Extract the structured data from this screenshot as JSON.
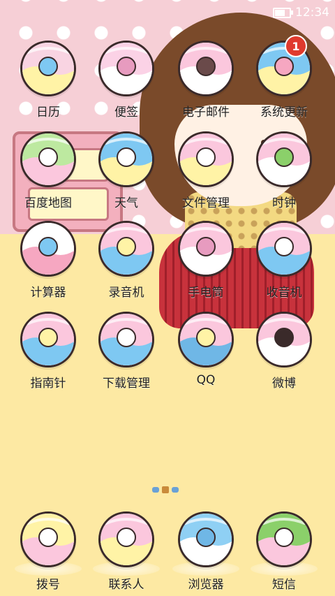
{
  "status_bar": {
    "time": "12:34",
    "battery_level_percent": 70
  },
  "apps": [
    {
      "id": "calendar",
      "label": "日历",
      "icon": "calendar-icon",
      "colors": [
        "#f9d4e2",
        "#fff3a6",
        "#7ec8f2"
      ]
    },
    {
      "id": "notes",
      "label": "便签",
      "icon": "memo-pencil-icon",
      "colors": [
        "#fbd2e6",
        "#fff",
        "#e79bbf"
      ]
    },
    {
      "id": "email",
      "label": "电子邮件",
      "icon": "envelope-icon",
      "colors": [
        "#fbc7dd",
        "#fff",
        "#6a4a4a"
      ]
    },
    {
      "id": "update",
      "label": "系统更新",
      "icon": "flower-update-icon",
      "colors": [
        "#7ec8f2",
        "#fff3a6",
        "#f6a7c1"
      ],
      "badge": "1"
    },
    {
      "id": "baidumap",
      "label": "百度地图",
      "icon": "car-map-icon",
      "colors": [
        "#bde9a0",
        "#fbc7dd",
        "#fff"
      ]
    },
    {
      "id": "weather",
      "label": "天气",
      "icon": "sun-cloud-icon",
      "colors": [
        "#7ec8f2",
        "#fff3a6",
        "#fff"
      ]
    },
    {
      "id": "files",
      "label": "文件管理",
      "icon": "folder-cake-icon",
      "colors": [
        "#fbc7dd",
        "#fff3a6",
        "#fff"
      ]
    },
    {
      "id": "clock",
      "label": "时钟",
      "icon": "alarm-clock-icon",
      "colors": [
        "#fbc7dd",
        "#fff",
        "#8bd06a"
      ]
    },
    {
      "id": "calculator",
      "label": "计算器",
      "icon": "calculator-icon",
      "colors": [
        "#fff",
        "#f6a7c1",
        "#7ec8f2"
      ]
    },
    {
      "id": "recorder",
      "label": "录音机",
      "icon": "microphone-icon",
      "colors": [
        "#fbc7dd",
        "#7ec8f2",
        "#fff3a6"
      ]
    },
    {
      "id": "flashlight",
      "label": "手电筒",
      "icon": "flashlight-icon",
      "colors": [
        "#fbc7dd",
        "#fff",
        "#e79bbf"
      ]
    },
    {
      "id": "radio",
      "label": "收音机",
      "icon": "radio-icon",
      "colors": [
        "#fbc7dd",
        "#7ec8f2",
        "#fff"
      ]
    },
    {
      "id": "compass",
      "label": "指南针",
      "icon": "compass-icon",
      "colors": [
        "#fbc7dd",
        "#7ec8f2",
        "#fff3a6"
      ]
    },
    {
      "id": "downloads",
      "label": "下载管理",
      "icon": "download-cloud-icon",
      "colors": [
        "#fbc7dd",
        "#7ec8f2",
        "#fff"
      ]
    },
    {
      "id": "qq",
      "label": "QQ",
      "icon": "penguin-icon",
      "colors": [
        "#fbc7dd",
        "#6fb7e6",
        "#fff3a6"
      ]
    },
    {
      "id": "weibo",
      "label": "微博",
      "icon": "eye-weibo-icon",
      "colors": [
        "#fbc7dd",
        "#fff",
        "#3a2a2a"
      ]
    }
  ],
  "dock": [
    {
      "id": "dialer",
      "label": "拨号",
      "icon": "telephone-icon",
      "colors": [
        "#fff3a6",
        "#fbc7dd",
        "#fff"
      ]
    },
    {
      "id": "contacts",
      "label": "联系人",
      "icon": "contact-card-icon",
      "colors": [
        "#fbc7dd",
        "#fff3a6",
        "#fff"
      ]
    },
    {
      "id": "browser",
      "label": "浏览器",
      "icon": "browser-e-icon",
      "colors": [
        "#8fd0f4",
        "#fff",
        "#6fb7e6"
      ]
    },
    {
      "id": "sms",
      "label": "短信",
      "icon": "message-bubble-icon",
      "colors": [
        "#8bd06a",
        "#fbc7dd",
        "#fff"
      ]
    }
  ],
  "pager": {
    "pages": 3,
    "current": 2
  }
}
